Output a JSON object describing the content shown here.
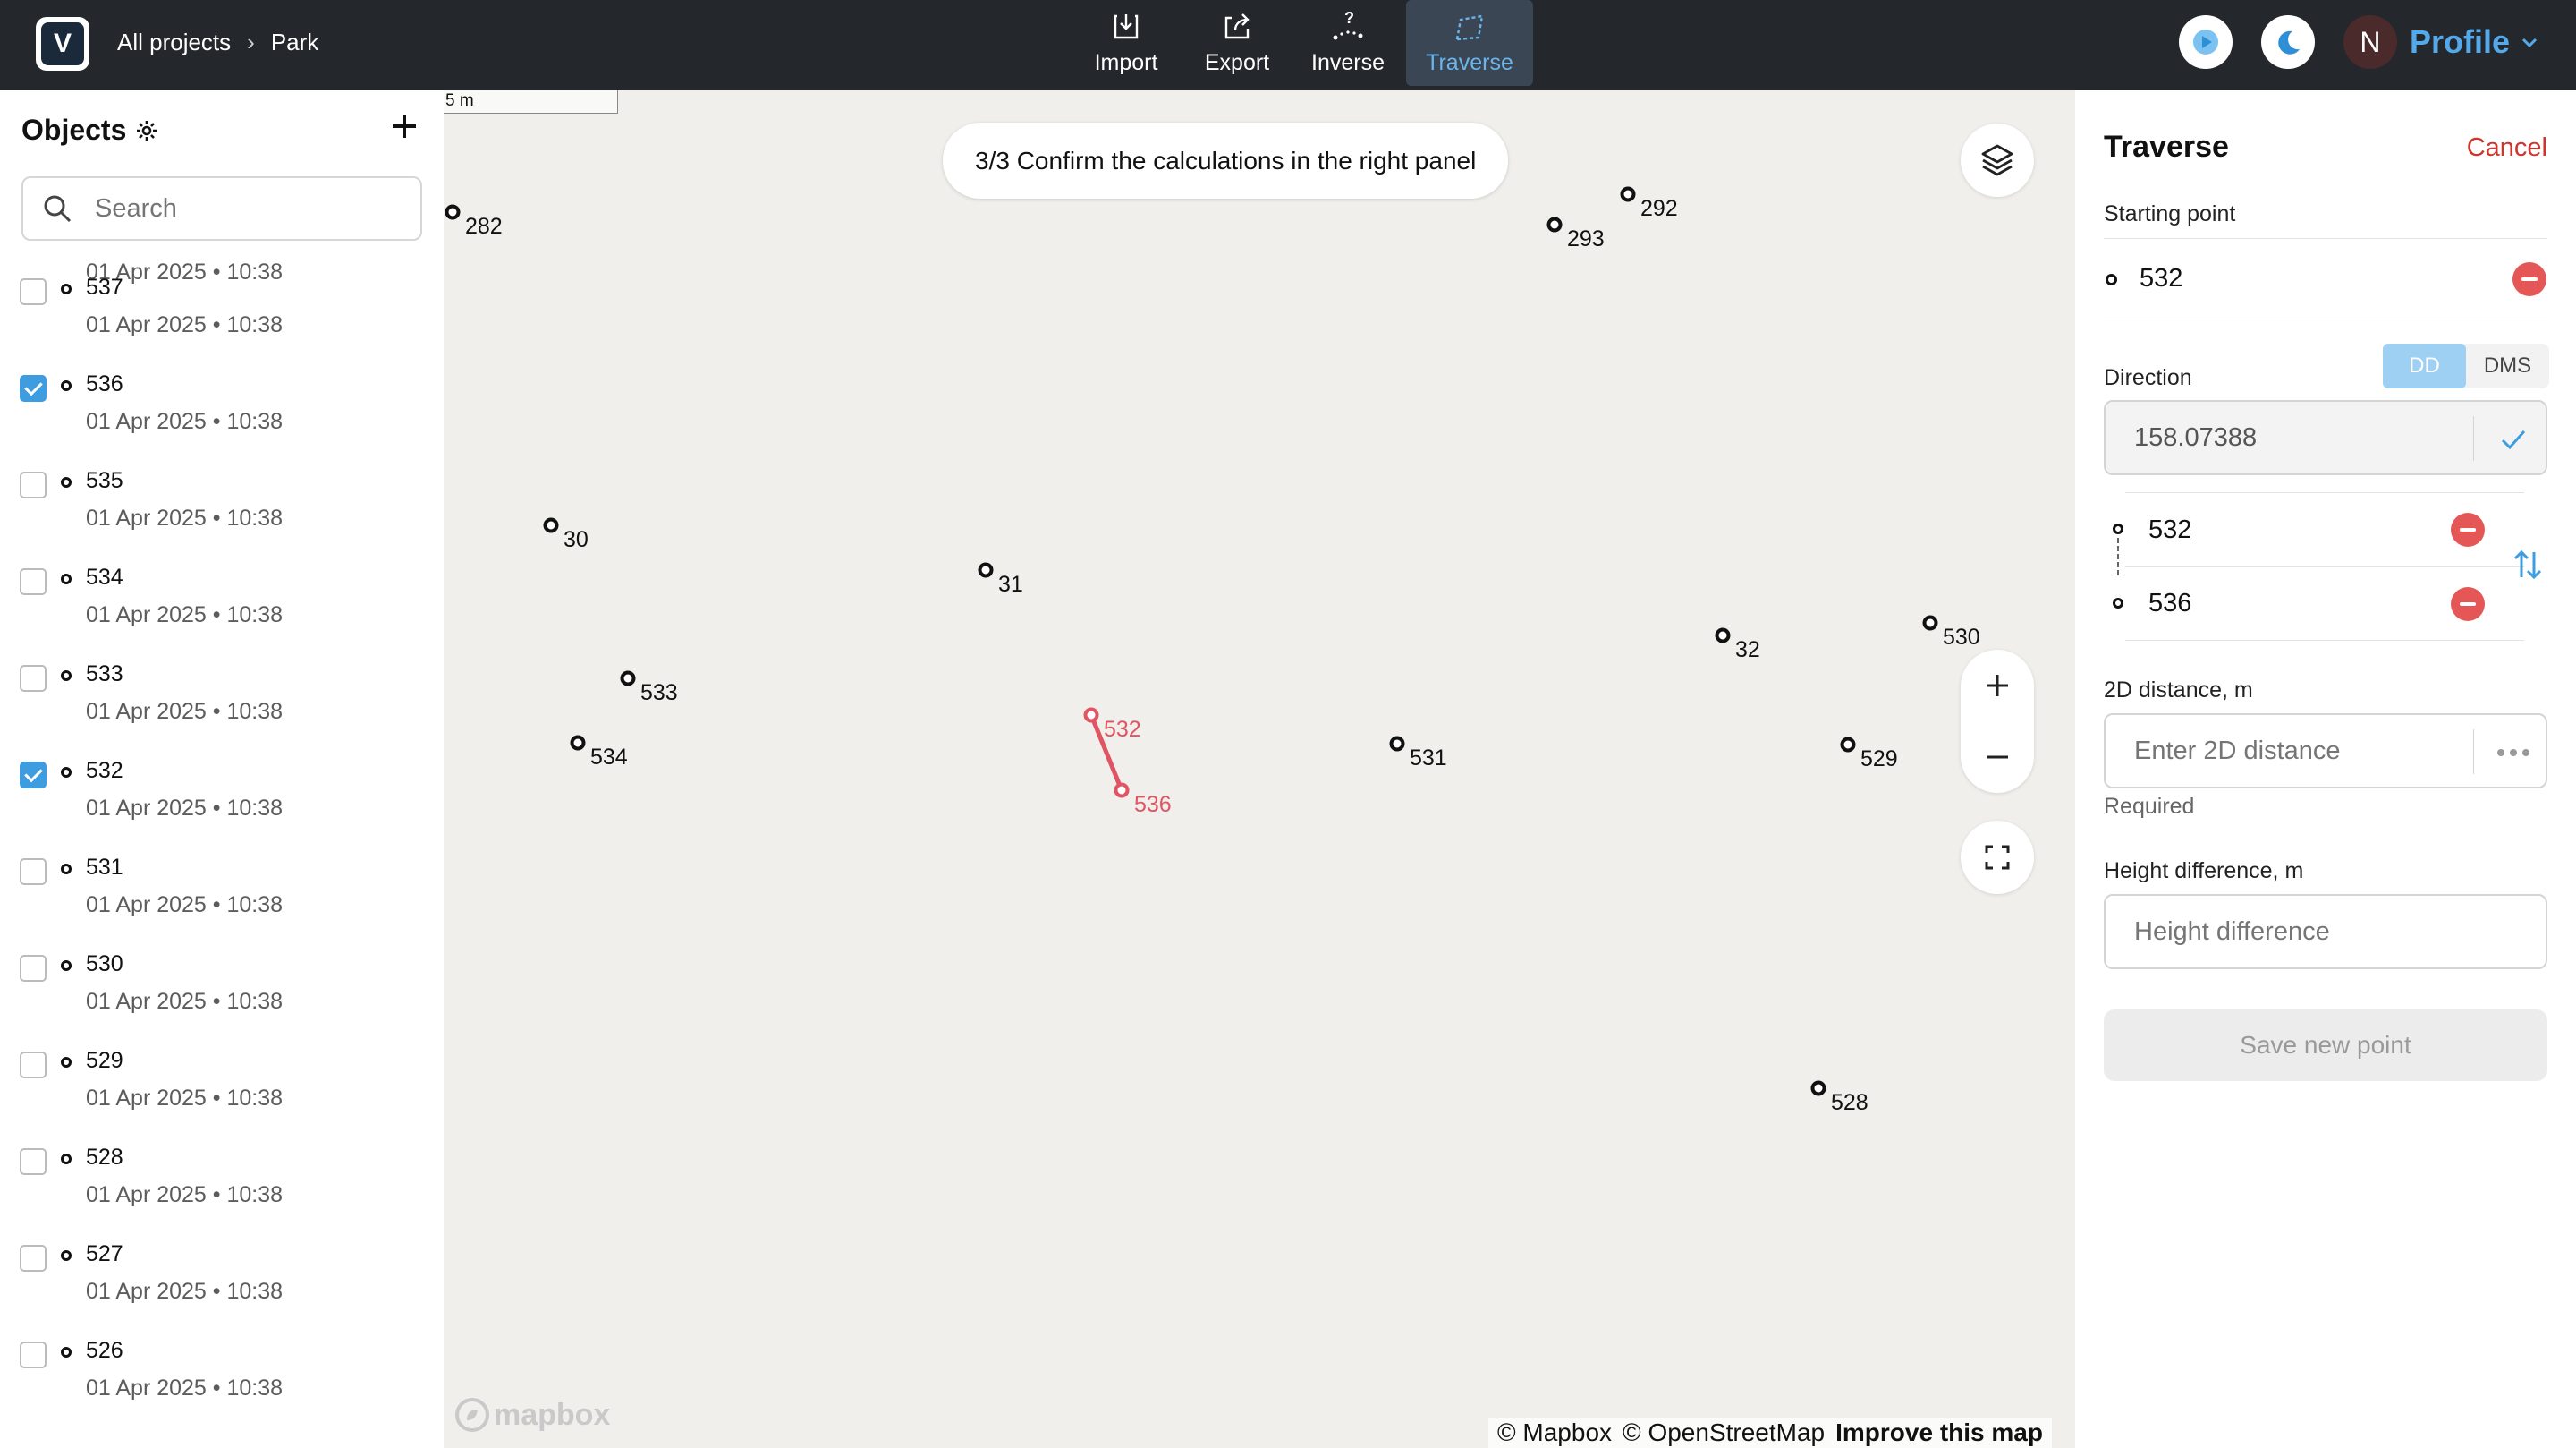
{
  "header": {
    "logo_letter": "V",
    "breadcrumb": [
      "All projects",
      "Park"
    ],
    "tools": [
      {
        "label": "Import",
        "icon": "import-icon"
      },
      {
        "label": "Export",
        "icon": "export-icon"
      },
      {
        "label": "Inverse",
        "icon": "inverse-icon"
      },
      {
        "label": "Traverse",
        "icon": "traverse-icon",
        "active": true
      }
    ],
    "avatar_initial": "N",
    "profile_label": "Profile"
  },
  "sidebar": {
    "title": "Objects",
    "search_placeholder": "Search",
    "first_date": "01 Apr 2025 • 10:38",
    "items": [
      {
        "name": "537",
        "date": "01 Apr 2025 • 10:38",
        "checked": false
      },
      {
        "name": "536",
        "date": "01 Apr 2025 • 10:38",
        "checked": true
      },
      {
        "name": "535",
        "date": "01 Apr 2025 • 10:38",
        "checked": false
      },
      {
        "name": "534",
        "date": "01 Apr 2025 • 10:38",
        "checked": false
      },
      {
        "name": "533",
        "date": "01 Apr 2025 • 10:38",
        "checked": false
      },
      {
        "name": "532",
        "date": "01 Apr 2025 • 10:38",
        "checked": true
      },
      {
        "name": "531",
        "date": "01 Apr 2025 • 10:38",
        "checked": false
      },
      {
        "name": "530",
        "date": "01 Apr 2025 • 10:38",
        "checked": false
      },
      {
        "name": "529",
        "date": "01 Apr 2025 • 10:38",
        "checked": false
      },
      {
        "name": "528",
        "date": "01 Apr 2025 • 10:38",
        "checked": false
      },
      {
        "name": "527",
        "date": "01 Apr 2025 • 10:38",
        "checked": false
      },
      {
        "name": "526",
        "date": "01 Apr 2025 • 10:38",
        "checked": false
      }
    ]
  },
  "map": {
    "scale_label": "5 m",
    "hint": "3/3 Confirm the calculations in the right panel",
    "points": [
      "282",
      "292",
      "293",
      "30",
      "31",
      "32",
      "530",
      "533",
      "534",
      "531",
      "529",
      "528"
    ],
    "highlighted_points": [
      "532",
      "536"
    ],
    "highlight_color": "#e05563",
    "mapbox_logo": "mapbox",
    "attribution_1": "© Mapbox",
    "attribution_2": "© OpenStreetMap",
    "attribution_3": "Improve this map"
  },
  "panel": {
    "title": "Traverse",
    "cancel_label": "Cancel",
    "starting_point_label": "Starting point",
    "starting_point": "532",
    "direction_label": "Direction",
    "dd_label": "DD",
    "dms_label": "DMS",
    "direction_value": "158.07388",
    "from_point": "532",
    "to_point": "536",
    "distance_label": "2D distance, m",
    "distance_placeholder": "Enter 2D distance",
    "required_label": "Required",
    "height_label": "Height difference, m",
    "height_placeholder": "Height difference",
    "save_label": "Save new point"
  },
  "colors": {
    "accent": "#53a9ea",
    "danger": "#e55656",
    "topbar": "#24282c"
  }
}
